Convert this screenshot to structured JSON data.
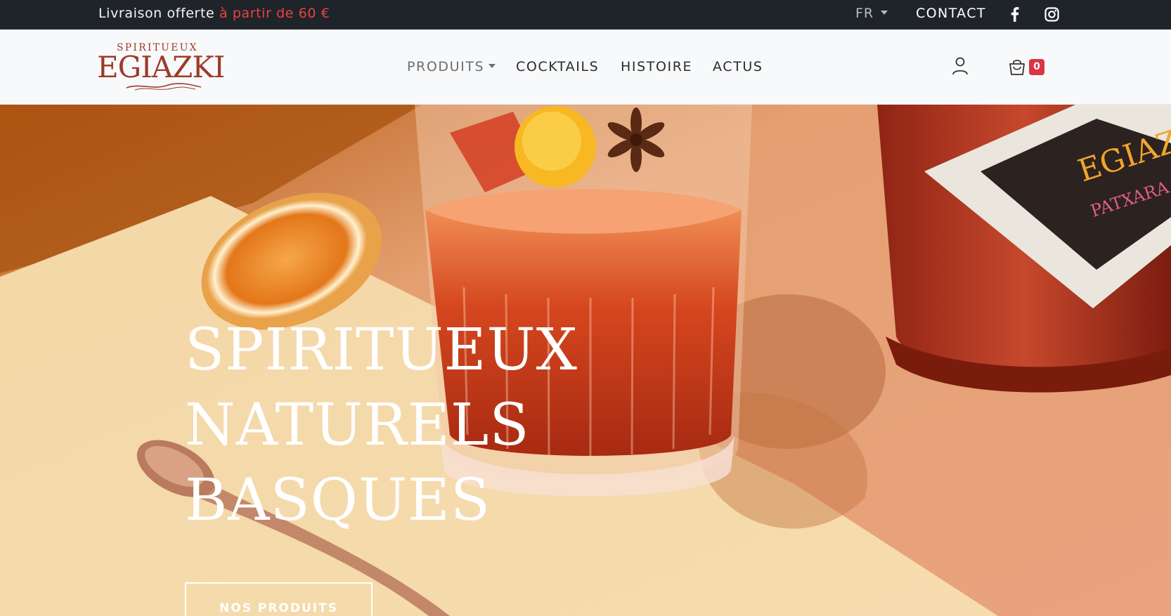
{
  "topbar": {
    "promo_prefix": "Livraison offerte",
    "promo_highlight": "à partir de 60 €",
    "language": "FR",
    "contact": "CONTACT",
    "social": [
      "facebook-icon",
      "instagram-icon"
    ]
  },
  "brand": {
    "tagline": "SPIRITUEUX",
    "name": "EGIAZKI"
  },
  "nav": {
    "items": [
      {
        "label": "PRODUITS",
        "has_dropdown": true
      },
      {
        "label": "COCKTAILS"
      },
      {
        "label": "HISTOIRE"
      },
      {
        "label": "ACTUS"
      }
    ],
    "cart_count": "0"
  },
  "hero": {
    "title_lines": [
      "SPIRITUEUX",
      "NATURELS",
      "BASQUES"
    ],
    "button": "NOS PRODUITS"
  },
  "colors": {
    "topbar_bg": "#1f232a",
    "promo_highlight": "#e8453c",
    "brand": "#9e3a28",
    "badge": "#dc3545",
    "nav_bg": "#f8f9fa"
  }
}
